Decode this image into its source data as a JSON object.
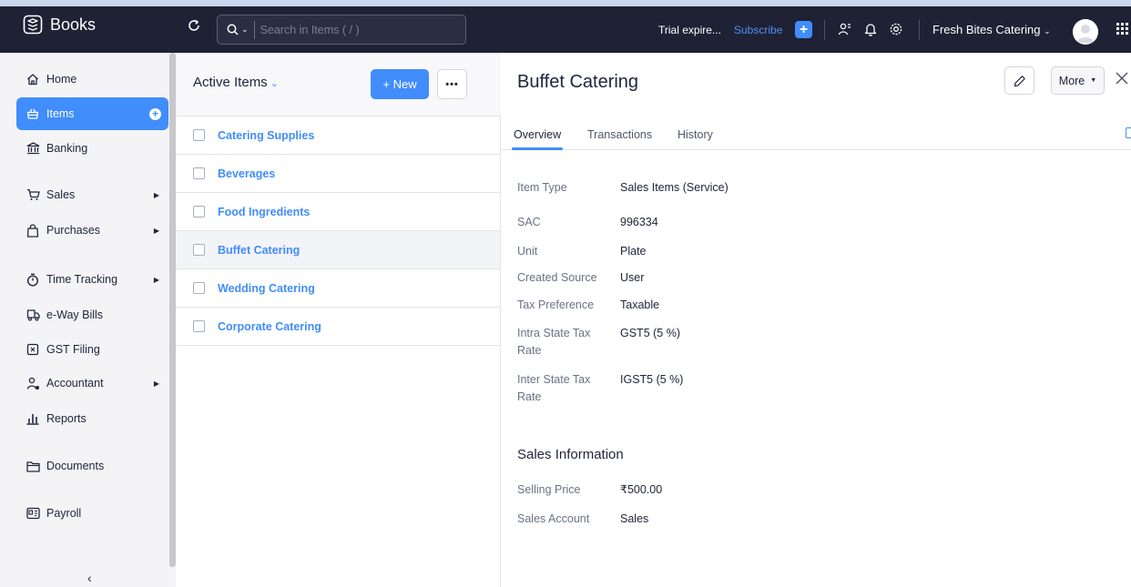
{
  "app": {
    "name": "Books"
  },
  "header": {
    "search_placeholder": "Search in Items ( / )",
    "trial": "Trial expire...",
    "subscribe": "Subscribe",
    "organization": "Fresh Bites Catering",
    "plus": "+"
  },
  "sidebar": {
    "items": [
      {
        "label": "Home",
        "icon": "home-icon"
      },
      {
        "label": "Items",
        "icon": "basket-icon",
        "active": true
      },
      {
        "label": "Banking",
        "icon": "bank-icon"
      },
      {
        "label": "Sales",
        "icon": "cart-icon",
        "has_arrow": true
      },
      {
        "label": "Purchases",
        "icon": "bag-icon",
        "has_arrow": true
      },
      {
        "label": "Time Tracking",
        "icon": "stopwatch-icon",
        "has_arrow": true
      },
      {
        "label": "e-Way Bills",
        "icon": "truck-icon"
      },
      {
        "label": "GST Filing",
        "icon": "gst-icon"
      },
      {
        "label": "Accountant",
        "icon": "accountant-icon",
        "has_arrow": true
      },
      {
        "label": "Reports",
        "icon": "reports-icon"
      },
      {
        "label": "Documents",
        "icon": "folder-icon"
      },
      {
        "label": "Payroll",
        "icon": "payroll-icon"
      }
    ],
    "collapse": "‹"
  },
  "list": {
    "title": "Active Items",
    "new_label": "+ New",
    "more_label": "•••",
    "items": [
      "Catering Supplies",
      "Beverages",
      "Food Ingredients",
      "Buffet Catering",
      "Wedding Catering",
      "Corporate Catering"
    ],
    "selected_index": 3
  },
  "detail": {
    "title": "Buffet Catering",
    "more_label": "More",
    "tabs": [
      "Overview",
      "Transactions",
      "History"
    ],
    "active_tab": 0,
    "fields": [
      {
        "label": "Item Type",
        "value": "Sales Items (Service)"
      },
      {
        "label": "SAC",
        "value": "996334"
      },
      {
        "label": "Unit",
        "value": "Plate"
      },
      {
        "label": "Created Source",
        "value": "User"
      },
      {
        "label": "Tax Preference",
        "value": "Taxable"
      },
      {
        "label": "Intra State Tax Rate",
        "value": "GST5 (5 %)"
      },
      {
        "label": "Inter State Tax Rate",
        "value": "IGST5 (5 %)"
      }
    ],
    "sales_section": {
      "title": "Sales Information",
      "fields": [
        {
          "label": "Selling Price",
          "value": "₹500.00"
        },
        {
          "label": "Sales Account",
          "value": "Sales"
        }
      ]
    }
  },
  "colors": {
    "accent": "#408dfb",
    "topbar": "#1f2235",
    "sidebar_bg": "#f4f4f6"
  }
}
